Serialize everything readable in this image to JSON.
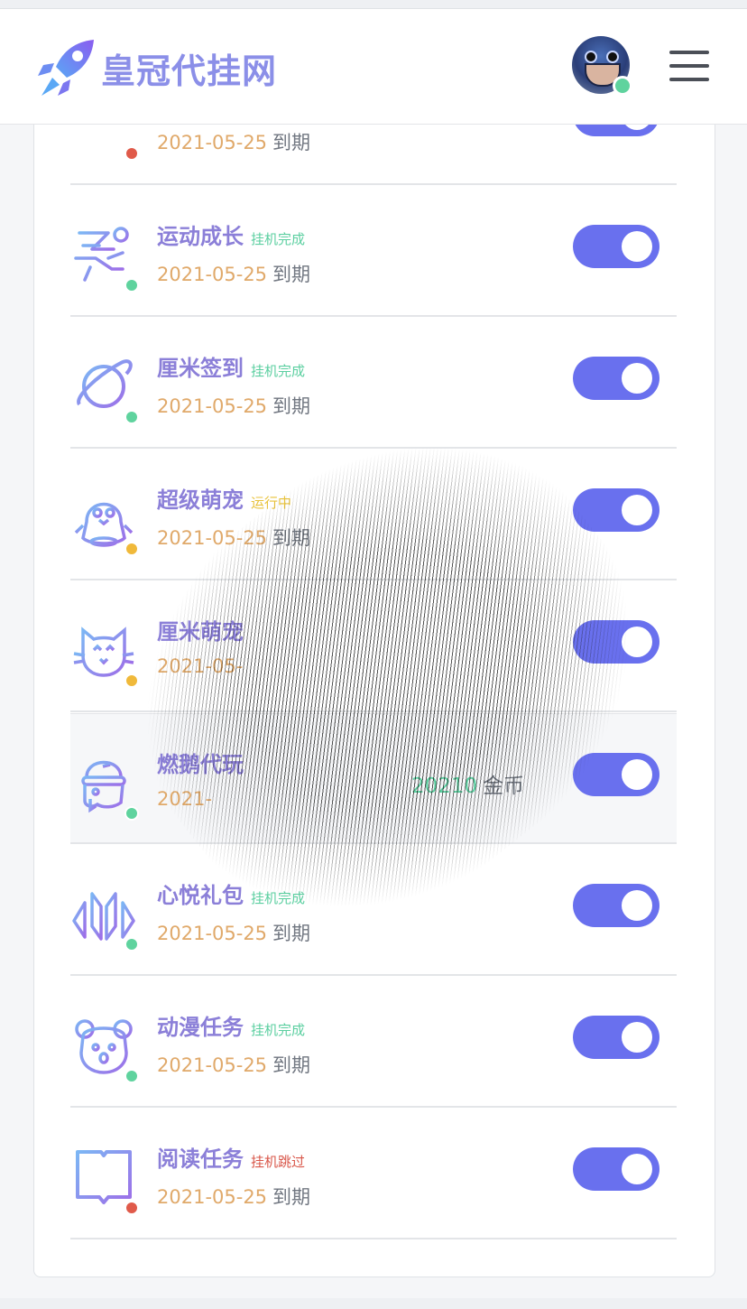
{
  "header": {
    "brand": "皇冠代挂网"
  },
  "rows": [
    {
      "title": "",
      "status": "",
      "status_color": "",
      "date": "2021-05-25",
      "date_suffix": "到期",
      "dot": "#e05a4a",
      "icon": "heart-icon"
    },
    {
      "title": "运动成长",
      "status": "挂机完成",
      "status_color": "#5bcfa0",
      "date": "2021-05-25",
      "date_suffix": "到期",
      "dot": "#5fd39e",
      "icon": "runner-icon"
    },
    {
      "title": "厘米签到",
      "status": "挂机完成",
      "status_color": "#5bcfa0",
      "date": "2021-05-25",
      "date_suffix": "到期",
      "dot": "#5fd39e",
      "icon": "planet-icon"
    },
    {
      "title": "超级萌宠",
      "status": "运行中",
      "status_color": "#e8c23a",
      "date": "2021-05-25",
      "date_suffix": "到期",
      "dot": "#f0b93a",
      "icon": "penguin-icon"
    },
    {
      "title": "厘米萌宠",
      "status": "",
      "status_color": "",
      "date": "2021-05-",
      "date_suffix": "",
      "dot": "#f0b93a",
      "icon": "cat-icon"
    },
    {
      "title": "燃鹅代玩",
      "status": "",
      "status_color": "",
      "date": "2021-",
      "date_suffix": "",
      "dot": "#5fd39e",
      "icon": "robot-icon",
      "coins": "20210",
      "coins_unit": "金币"
    },
    {
      "title": "心悦礼包",
      "status": "挂机完成",
      "status_color": "#5bcfa0",
      "date": "2021-05-25",
      "date_suffix": "到期",
      "dot": "#5fd39e",
      "icon": "arrows-icon"
    },
    {
      "title": "动漫任务",
      "status": "挂机完成",
      "status_color": "#5bcfa0",
      "date": "2021-05-25",
      "date_suffix": "到期",
      "dot": "#5fd39e",
      "icon": "bear-icon"
    },
    {
      "title": "阅读任务",
      "status": "挂机跳过",
      "status_color": "#d9574a",
      "date": "2021-05-25",
      "date_suffix": "到期",
      "dot": "#e05a4a",
      "icon": "book-icon"
    }
  ],
  "colors": {
    "accent": "#6970ee",
    "title": "#8b7fd8",
    "date": "#e0a96a"
  }
}
